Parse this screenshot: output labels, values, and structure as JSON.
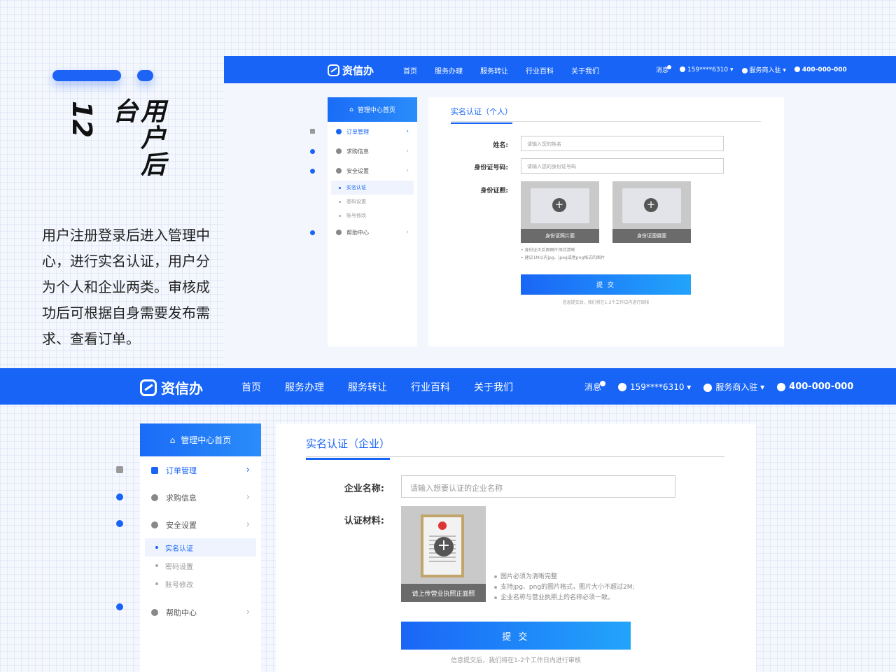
{
  "intro": {
    "number": "12",
    "heading": "用户后台",
    "description": "用户注册登录后进入管理中心，进行实名认证，用户分为个人和企业两类。审核成功后可根据自身需要发布需求、查看订单。"
  },
  "nav": {
    "brand": "资信办",
    "menu": [
      "首页",
      "服务办理",
      "服务转让",
      "行业百科",
      "关于我们"
    ],
    "messages": "消息",
    "user": "159****6310",
    "merchant": "服务商入驻",
    "phone": "400-000-000"
  },
  "sidebar": {
    "home": "管理中心首页",
    "items": [
      "订单管理",
      "求购信息",
      "安全设置"
    ],
    "sub_items": [
      "实名认证",
      "密码设置",
      "账号修改"
    ],
    "help": "帮助中心",
    "chevron": "›"
  },
  "personal_form": {
    "title": "实名认证（个人）",
    "name_label": "姓名:",
    "name_placeholder": "请输入您的姓名",
    "id_label": "身份证号码:",
    "id_placeholder": "请输入您的身份证号码",
    "photo_label": "身份证照:",
    "front_caption": "身份证照片面",
    "back_caption": "身份证国徽面",
    "tips": [
      "身份证正反面图片保持清晰",
      "建议1M以内jpg、jpeg或者png格式的图片"
    ],
    "submit": "提 交",
    "note": "信息提交后，我们将在1-2个工作日内进行审核"
  },
  "company_form": {
    "title": "实名认证（企业）",
    "name_label": "企业名称:",
    "name_placeholder": "请输入想要认证的企业名称",
    "material_label": "认证材料:",
    "upload_caption": "请上传营业执照正面照",
    "tips": [
      "图片必须为清晰完整",
      "支持jpg、png的图片格式，图片大小不超过2M;",
      "企业名称与营业执照上的名称必须一致。"
    ],
    "submit": "提 交",
    "note": "信息提交后，我们将在1-2个工作日内进行审核"
  },
  "colors": {
    "primary": "#1764f6",
    "gradient_end": "#22a4fb"
  },
  "icons": [
    "logo-icon",
    "home-icon",
    "clipboard-icon",
    "chat-icon",
    "shield-icon",
    "help-icon",
    "user-icon",
    "store-icon",
    "phone-icon",
    "plus-icon",
    "chevron-right-icon"
  ]
}
